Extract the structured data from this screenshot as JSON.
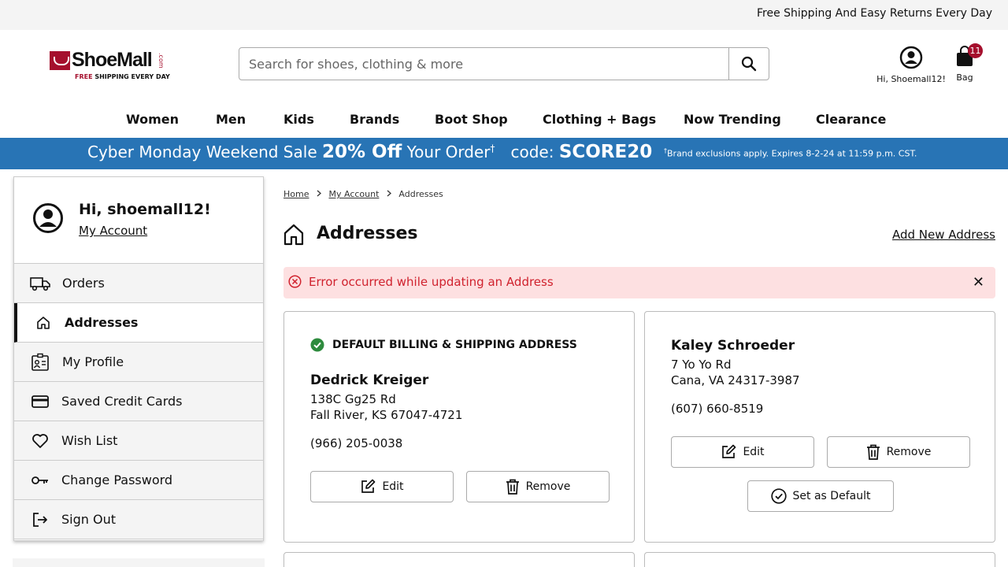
{
  "topbar": {
    "text": "Free Shipping And Easy Returns Every Day"
  },
  "logo": {
    "brand_shoe": "Shoe",
    "brand_mall": "Mall",
    "brand_com": ".com",
    "tag_free": "FREE",
    "tag_rest": " SHIPPING EVERY DAY"
  },
  "search": {
    "placeholder": "Search for shoes, clothing & more",
    "value": ""
  },
  "account": {
    "label": "Hi, Shoemall12!"
  },
  "bag": {
    "label": "Bag",
    "count": "11"
  },
  "nav": [
    "Women",
    "Men",
    "Kids",
    "Brands",
    "Boot Shop",
    "Clothing + Bags",
    "Now Trending",
    "Clearance"
  ],
  "promo": {
    "lead": "Cyber Monday Weekend Sale ",
    "discount": "20% Off",
    "tail": " Your Order",
    "dagger": "†",
    "code_label": "code: ",
    "code": "SCORE20",
    "fine_dagger": "†",
    "fine": "Brand exclusions apply. Expires 8-2-24 at 11:59 p.m. CST."
  },
  "sidebar": {
    "greeting": "Hi, shoemall12!",
    "account_link": "My Account",
    "items": [
      {
        "label": "Orders",
        "icon": "truck-icon"
      },
      {
        "label": "Addresses",
        "icon": "home-icon",
        "active": true
      },
      {
        "label": "My Profile",
        "icon": "profile-card-icon"
      },
      {
        "label": "Saved Credit Cards",
        "icon": "credit-card-icon"
      },
      {
        "label": "Wish List",
        "icon": "heart-icon"
      },
      {
        "label": "Change Password",
        "icon": "key-icon"
      },
      {
        "label": "Sign Out",
        "icon": "sign-out-icon"
      }
    ]
  },
  "breadcrumb": {
    "home": "Home",
    "account": "My Account",
    "current": "Addresses"
  },
  "page": {
    "title": "Addresses",
    "add_link": "Add New Address"
  },
  "alert": {
    "text": "Error occurred while updating an Address",
    "close": "✕",
    "color": "#d0222e"
  },
  "addresses": [
    {
      "default_label": "DEFAULT BILLING & SHIPPING ADDRESS",
      "name": "Dedrick Kreiger",
      "street": "138C Gg25 Rd",
      "city": "Fall River, KS 67047-4721",
      "phone": "(966) 205-0038",
      "edit": "Edit",
      "remove": "Remove"
    },
    {
      "name": "Kaley Schroeder",
      "street": "7 Yo Yo Rd",
      "city": "Cana, VA 24317-3987",
      "phone": "(607) 660-8519",
      "edit": "Edit",
      "remove": "Remove",
      "set_default": "Set as Default"
    }
  ],
  "colors": {
    "brand": "#a50f2d",
    "promo_bg": "#2874b5",
    "alert_bg": "#fde0e1",
    "success": "#2e8b3e"
  }
}
